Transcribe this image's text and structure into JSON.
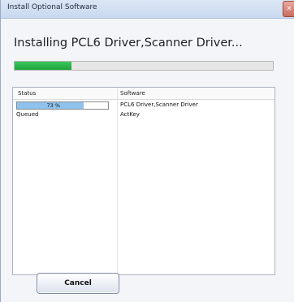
{
  "window": {
    "title": "Install Optional Software"
  },
  "heading": "Installing PCL6 Driver,Scanner Driver...",
  "overall_progress": {
    "fraction": 0.22
  },
  "list": {
    "columns": [
      "Status",
      "Software"
    ],
    "rows": [
      {
        "status_type": "progress",
        "percent_label": "73 %",
        "fraction": 0.73,
        "software": "PCL6 Driver,Scanner Driver"
      },
      {
        "status_type": "text",
        "status": "Queued",
        "software": "ActKey"
      }
    ]
  },
  "buttons": {
    "cancel": "Cancel"
  },
  "colors": {
    "progress_green": "#2bbb4c",
    "row_progress_blue": "#8fc3ee",
    "close_red": "#c96d5f"
  }
}
